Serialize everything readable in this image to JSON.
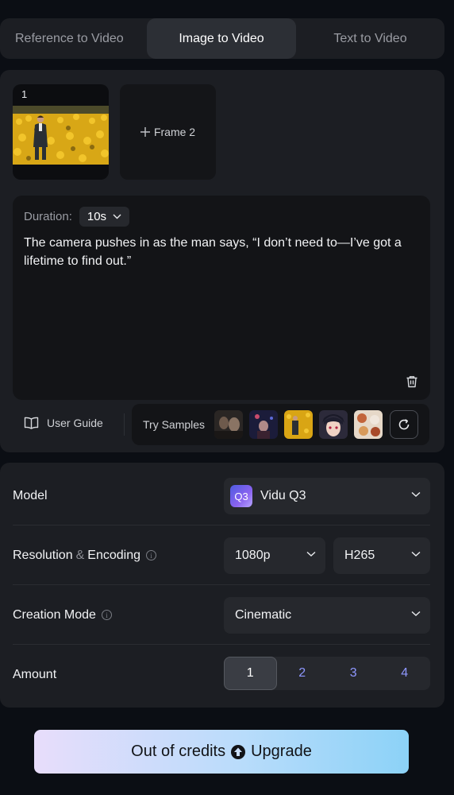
{
  "tabs": [
    {
      "label": "Reference to Video"
    },
    {
      "label": "Image to Video"
    },
    {
      "label": "Text to Video"
    }
  ],
  "frames": {
    "frame1_number": "1",
    "frame2_label": "Frame 2"
  },
  "prompt": {
    "duration_label": "Duration:",
    "duration_value": "10s",
    "text": "The camera pushes in as the man says, “I don’t need to—I’ve got a lifetime to find out.”"
  },
  "footer": {
    "user_guide": "User Guide",
    "try_samples": "Try Samples"
  },
  "settings": {
    "model_label": "Model",
    "model_badge": "Q3",
    "model_value": "Vidu Q3",
    "resolution_label": "Resolution",
    "resolution_amp": "&",
    "encoding_label": "Encoding",
    "resolution_value": "1080p",
    "encoding_value": "H265",
    "creation_mode_label": "Creation Mode",
    "creation_mode_value": "Cinematic",
    "amount_label": "Amount",
    "amounts": [
      "1",
      "2",
      "3",
      "4"
    ],
    "info_glyph": "i"
  },
  "upgrade": {
    "left": "Out of credits",
    "right": "Upgrade"
  },
  "colors": {
    "background": "#0b0e14",
    "panel": "#1c1e23",
    "accent_amount": "#8f98ff"
  }
}
